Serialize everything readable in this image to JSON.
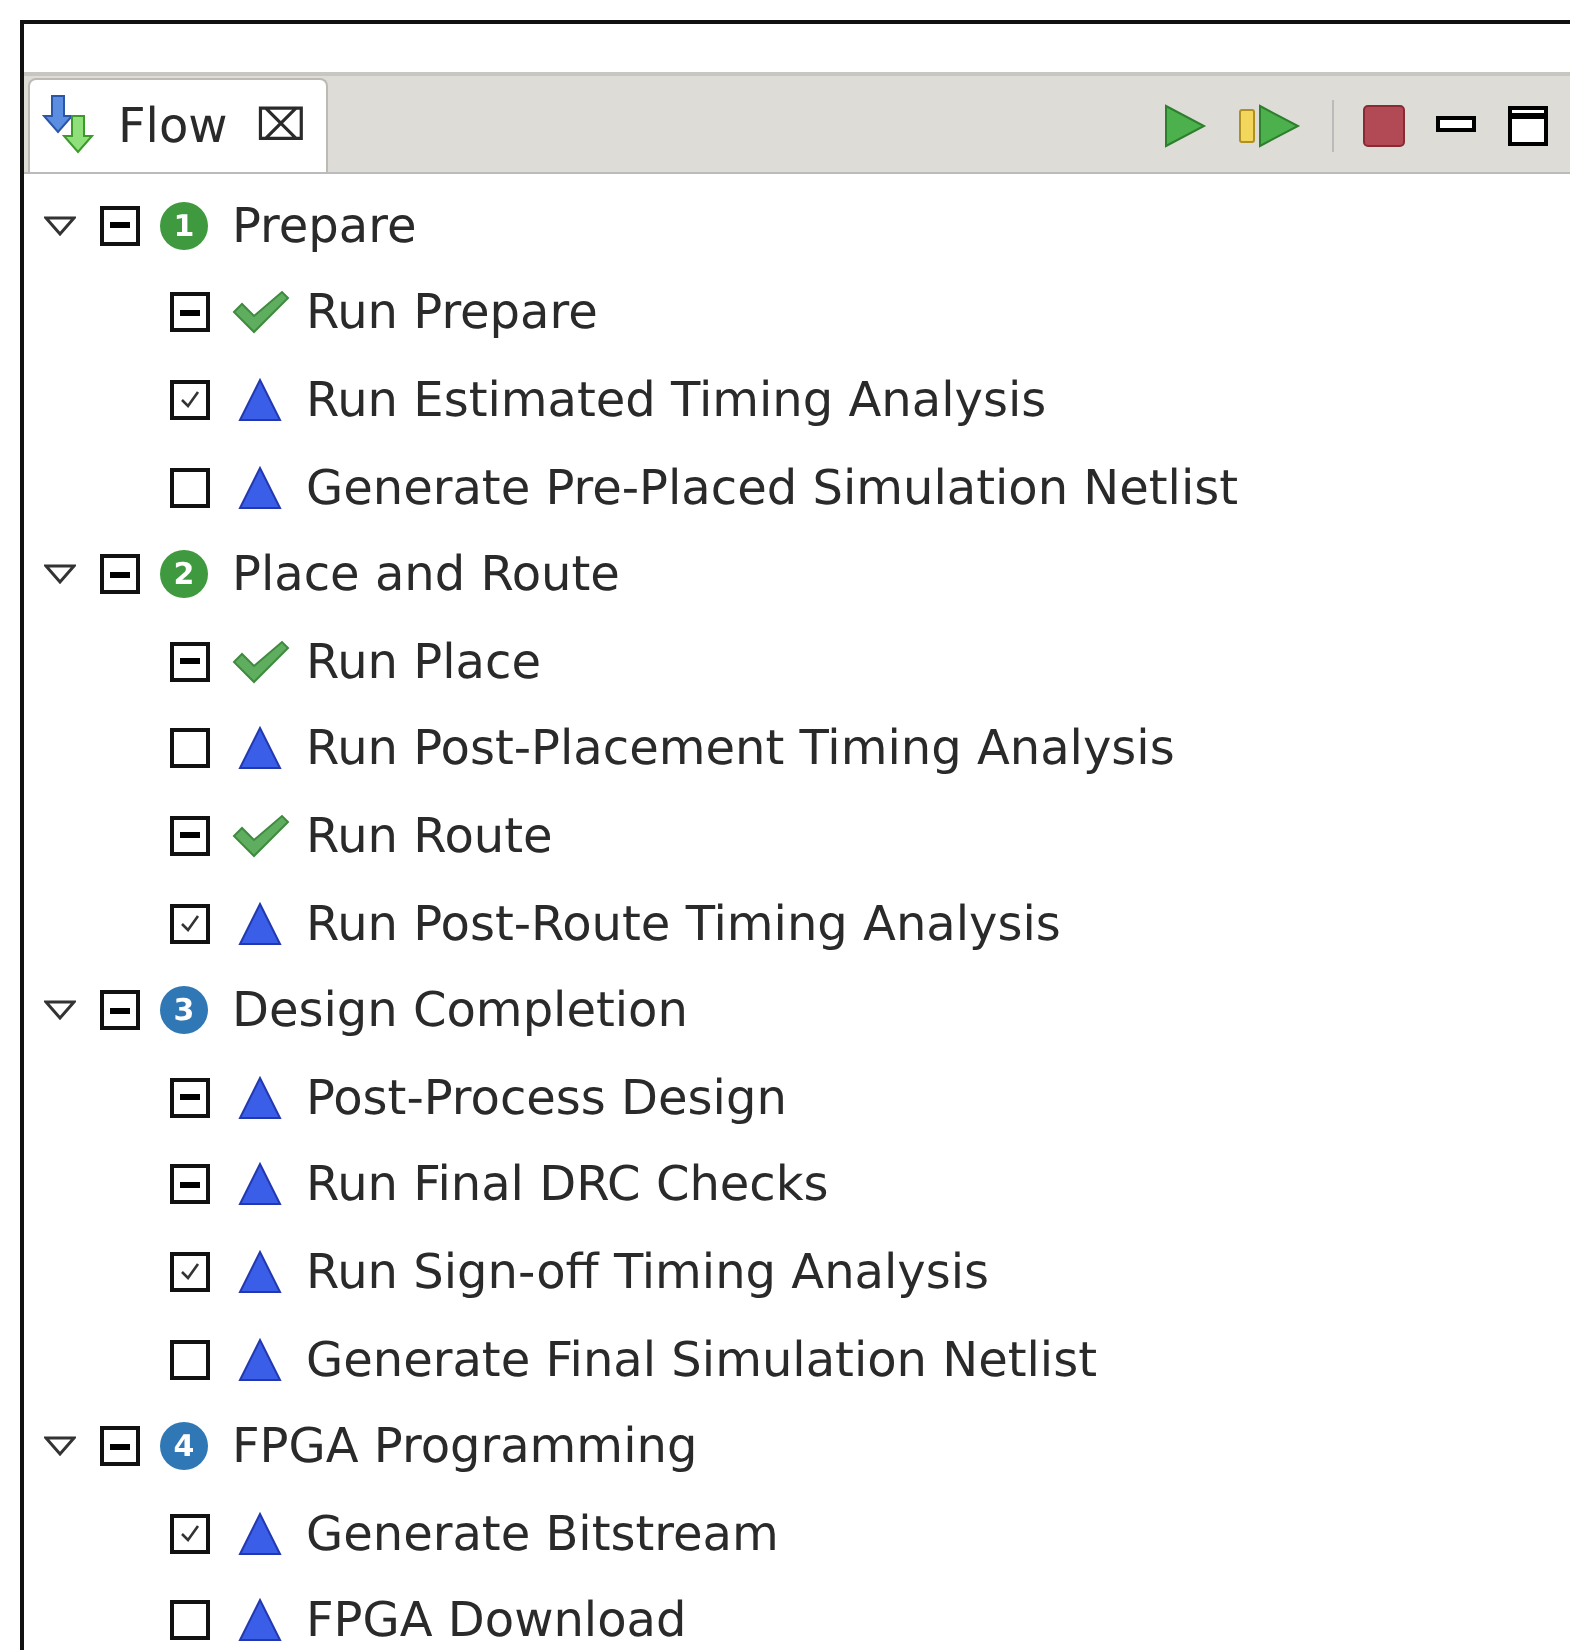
{
  "tab": {
    "label": "Flow",
    "close": "⌧"
  },
  "groups": [
    {
      "number": "1",
      "color": "#3f9a3f",
      "label": "Prepare",
      "expanded": true,
      "partial": true,
      "children": [
        {
          "label": "Run Prepare",
          "kind": "done",
          "checked": true,
          "partial": true
        },
        {
          "label": "Run Estimated Timing Analysis",
          "kind": "pending",
          "checked": true,
          "partial": false
        },
        {
          "label": "Generate Pre-Placed Simulation Netlist",
          "kind": "pending",
          "checked": false,
          "partial": false
        }
      ]
    },
    {
      "number": "2",
      "color": "#3f9a3f",
      "label": "Place and Route",
      "expanded": true,
      "partial": true,
      "children": [
        {
          "label": "Run Place",
          "kind": "done",
          "checked": true,
          "partial": true
        },
        {
          "label": "Run Post-Placement Timing Analysis",
          "kind": "pending",
          "checked": false,
          "partial": false
        },
        {
          "label": "Run Route",
          "kind": "done",
          "checked": true,
          "partial": true
        },
        {
          "label": "Run Post-Route Timing Analysis",
          "kind": "pending",
          "checked": true,
          "partial": false
        }
      ]
    },
    {
      "number": "3",
      "color": "#2f78b5",
      "label": "Design Completion",
      "expanded": true,
      "partial": true,
      "children": [
        {
          "label": "Post-Process Design",
          "kind": "pending",
          "checked": true,
          "partial": true
        },
        {
          "label": "Run Final DRC Checks",
          "kind": "pending",
          "checked": true,
          "partial": true
        },
        {
          "label": "Run Sign-off Timing Analysis",
          "kind": "pending",
          "checked": true,
          "partial": false
        },
        {
          "label": "Generate Final Simulation Netlist",
          "kind": "pending",
          "checked": false,
          "partial": false
        }
      ]
    },
    {
      "number": "4",
      "color": "#2f78b5",
      "label": "FPGA Programming",
      "expanded": true,
      "partial": true,
      "children": [
        {
          "label": "Generate Bitstream",
          "kind": "pending",
          "checked": true,
          "partial": false
        },
        {
          "label": "FPGA Download",
          "kind": "pending",
          "checked": false,
          "partial": false
        }
      ]
    }
  ]
}
